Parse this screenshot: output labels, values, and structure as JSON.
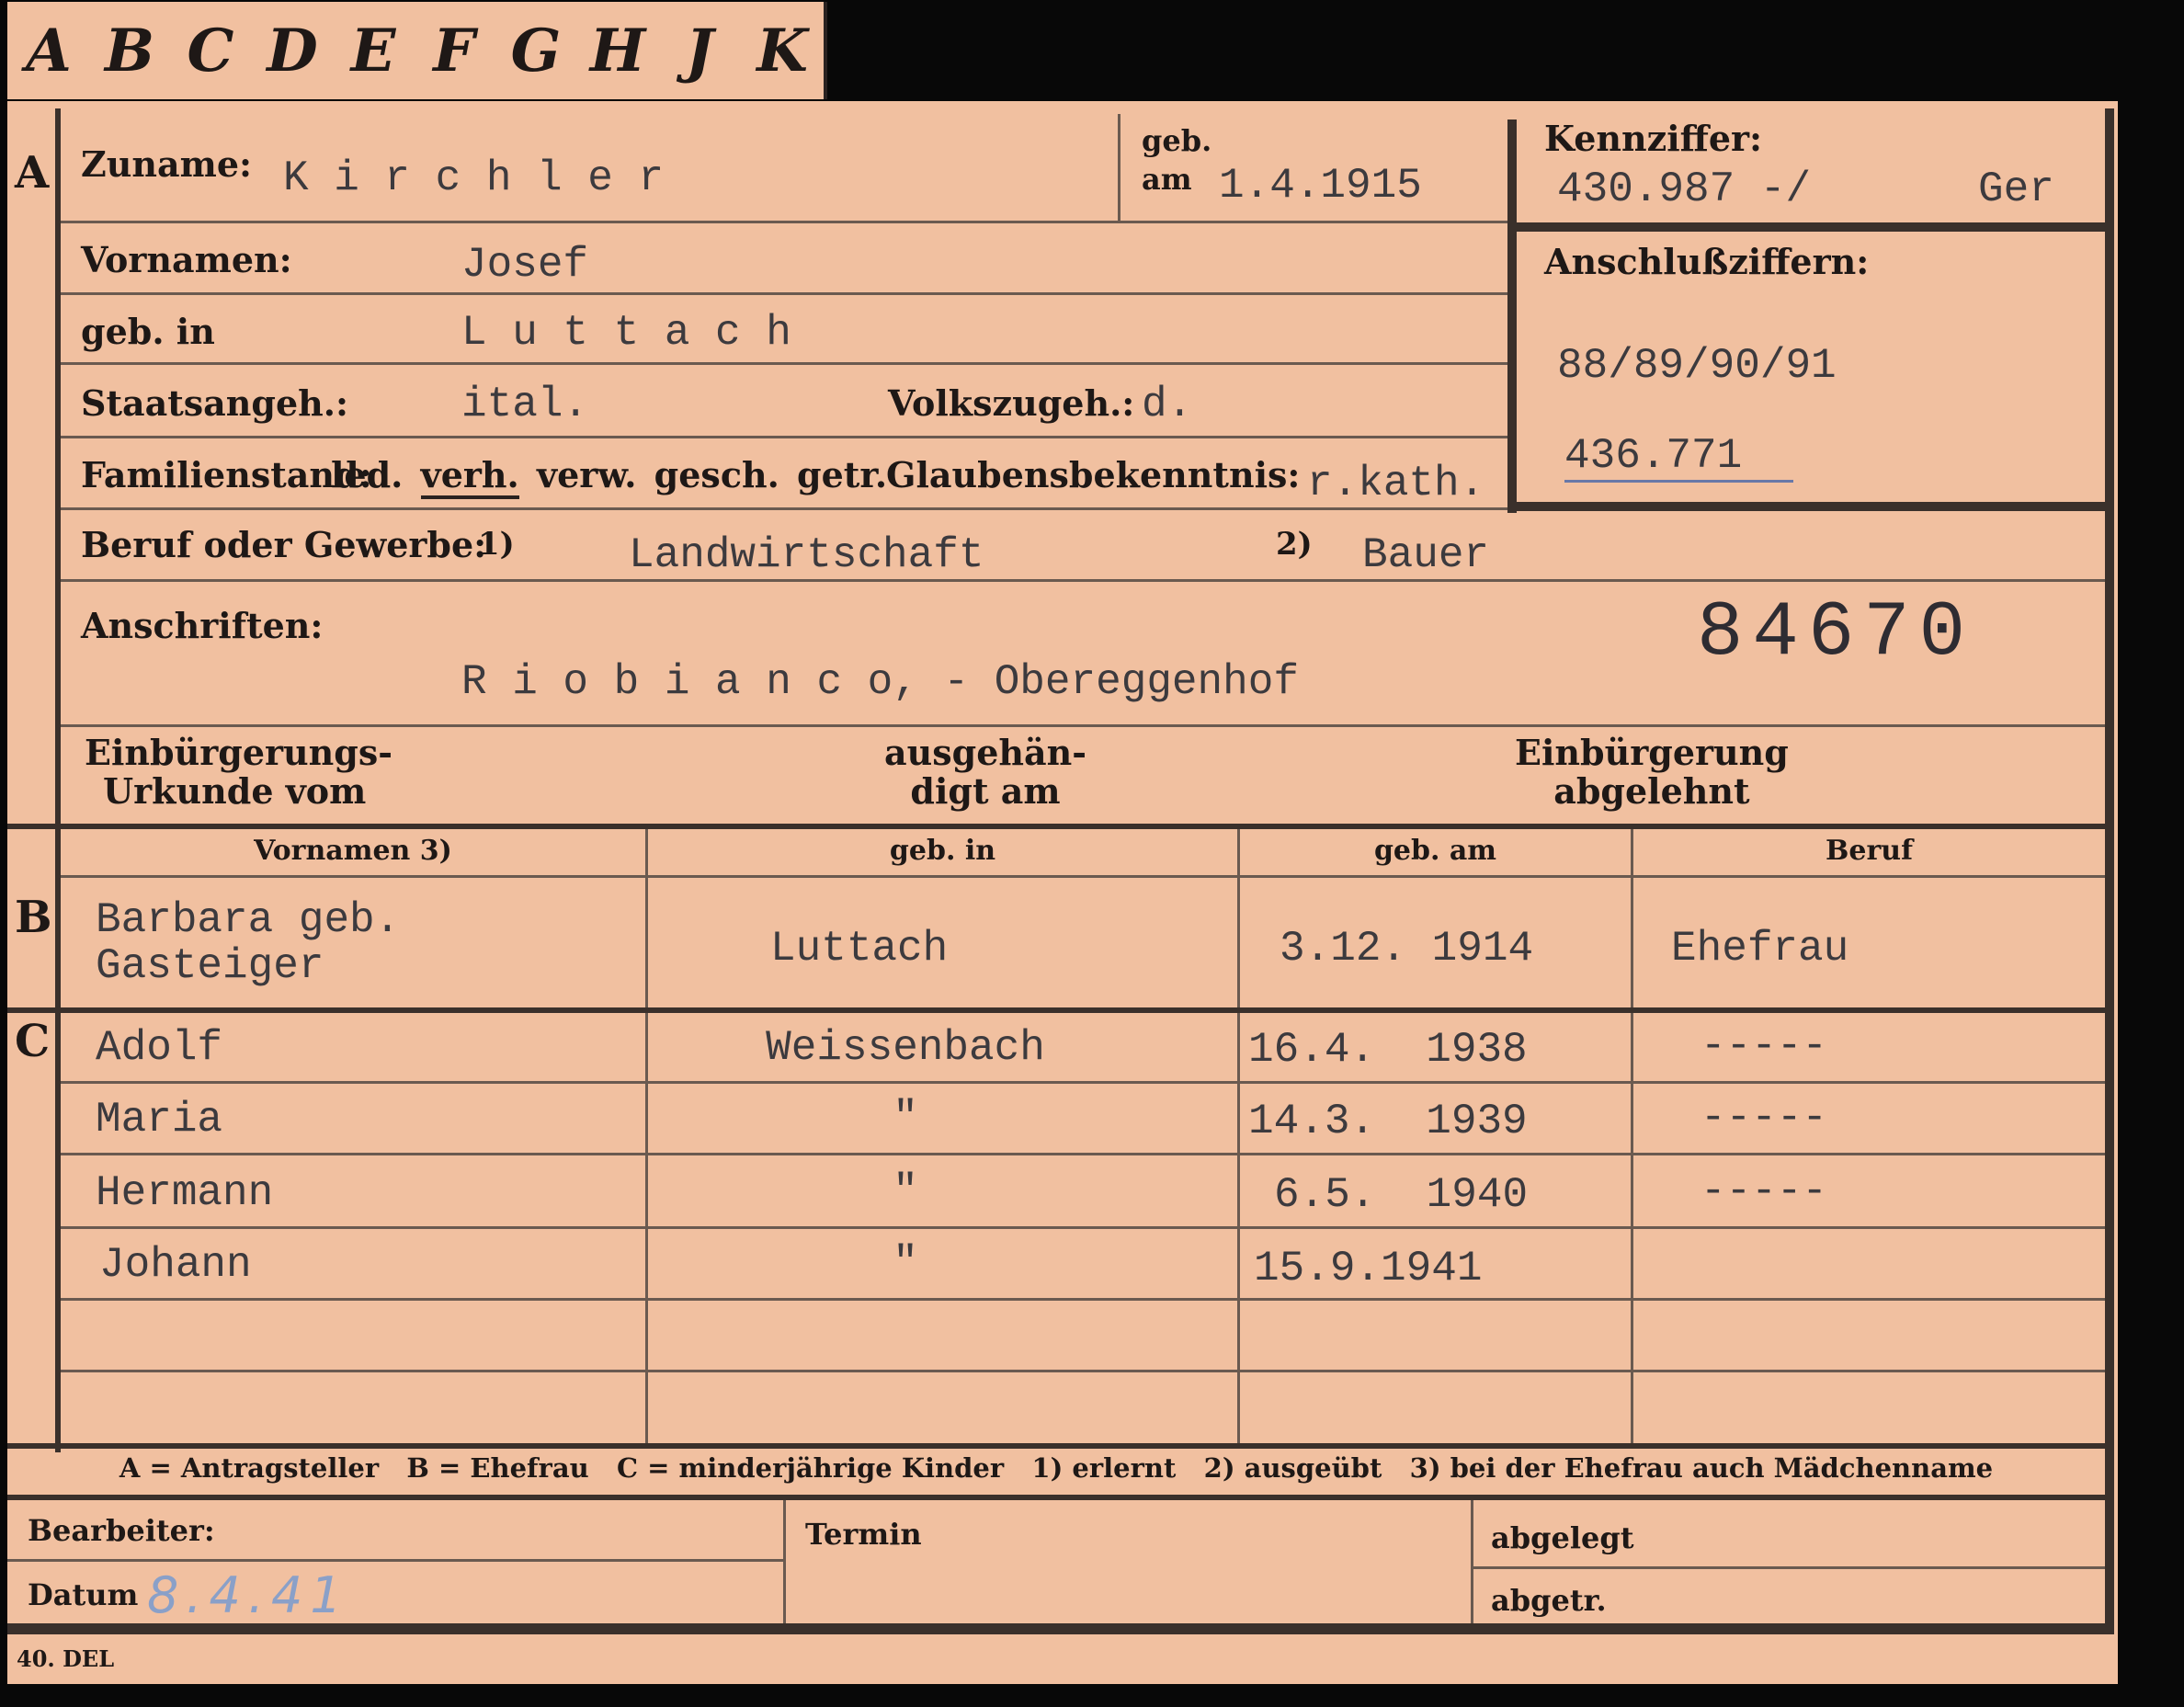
{
  "index_tabs": [
    "A",
    "B",
    "C",
    "D",
    "E",
    "F",
    "G",
    "H",
    "J",
    "K"
  ],
  "section_letters": {
    "a": "A",
    "b": "B",
    "c": "C"
  },
  "labels": {
    "zuname": "Zuname:",
    "geb_am_line1": "geb.",
    "geb_am_line2": "am",
    "kennziffer": "Kennziffer:",
    "anschlussziffern": "Anschlußziffern:",
    "vornamen": "Vornamen:",
    "geb_in": "geb. in",
    "staatsangeh": "Staatsangeh.:",
    "volkszugeh": "Volkszugeh.:",
    "familienstand_label": "Familienstand:",
    "familienstand_options": [
      "led.",
      "verh.",
      "verw.",
      "gesch.",
      "getr."
    ],
    "glaubensbekenntnis": "Glaubensbekenntnis:",
    "beruf": "Beruf oder Gewerbe:",
    "beruf_note1": "1)",
    "beruf_note2": "2)",
    "anschriften": "Anschriften:",
    "einb_urkunde_1": "Einbürgerungs-",
    "einb_urkunde_2": "Urkunde vom",
    "ausgehaendigt_1": "ausgehän-",
    "ausgehaendigt_2": "digt am",
    "einb_abgelehnt_1": "Einbürgerung",
    "einb_abgelehnt_2": "abgelehnt"
  },
  "values": {
    "zuname": "K i r c h l e r",
    "geb_am": "1.4.1915",
    "kennziffer": "430.987 -/",
    "kennziffer_suffix": "Ger",
    "anschlussziffern_1": "88/89/90/91",
    "anschlussziffern_2": "436.771",
    "vornamen": "Josef",
    "geb_in": "L u t t a c h",
    "staatsangeh": "ital.",
    "volkszugeh": "d.",
    "glaubensbekenntnis": "r.kath.",
    "beruf_1": "Landwirtschaft",
    "beruf_2": "Bauer",
    "anschrift": "R i o b i a n c o, - Obereggenhof",
    "stamp_number": "84670"
  },
  "family_table": {
    "headers": [
      "Vornamen 3)",
      "geb. in",
      "geb. am",
      "Beruf"
    ],
    "spouse": {
      "name_line1": "Barbara geb.",
      "name_line2": "Gasteiger",
      "geb_in": "Luttach",
      "geb_am": "3.12. 1914",
      "beruf": "Ehefrau"
    },
    "children": [
      {
        "name": "Adolf",
        "geb_in": "Weissenbach",
        "geb_am": "16.4.  1938",
        "beruf": "-----"
      },
      {
        "name": "Maria",
        "geb_in": "\"",
        "geb_am": "14.3.  1939",
        "beruf": "-----"
      },
      {
        "name": "Hermann",
        "geb_in": "\"",
        "geb_am": "6.5.  1940",
        "beruf": "-----"
      },
      {
        "name": "Johann",
        "geb_in": "\"",
        "geb_am": "15.9.1941",
        "beruf": ""
      },
      {
        "name": "",
        "geb_in": "",
        "geb_am": "",
        "beruf": ""
      },
      {
        "name": "",
        "geb_in": "",
        "geb_am": "",
        "beruf": ""
      }
    ]
  },
  "legend": "A = Antragsteller   B = Ehefrau   C = minderjährige Kinder   1) erlernt   2) ausgeübt   3) bei der Ehefrau auch Mädchenname",
  "footer": {
    "bearbeiter": "Bearbeiter:",
    "datum_label": "Datum",
    "datum_value": "8.4.41",
    "termin": "Termin",
    "abgelegt": "abgelegt",
    "abgetr": "abgetr."
  },
  "print_code": "40. DEL"
}
